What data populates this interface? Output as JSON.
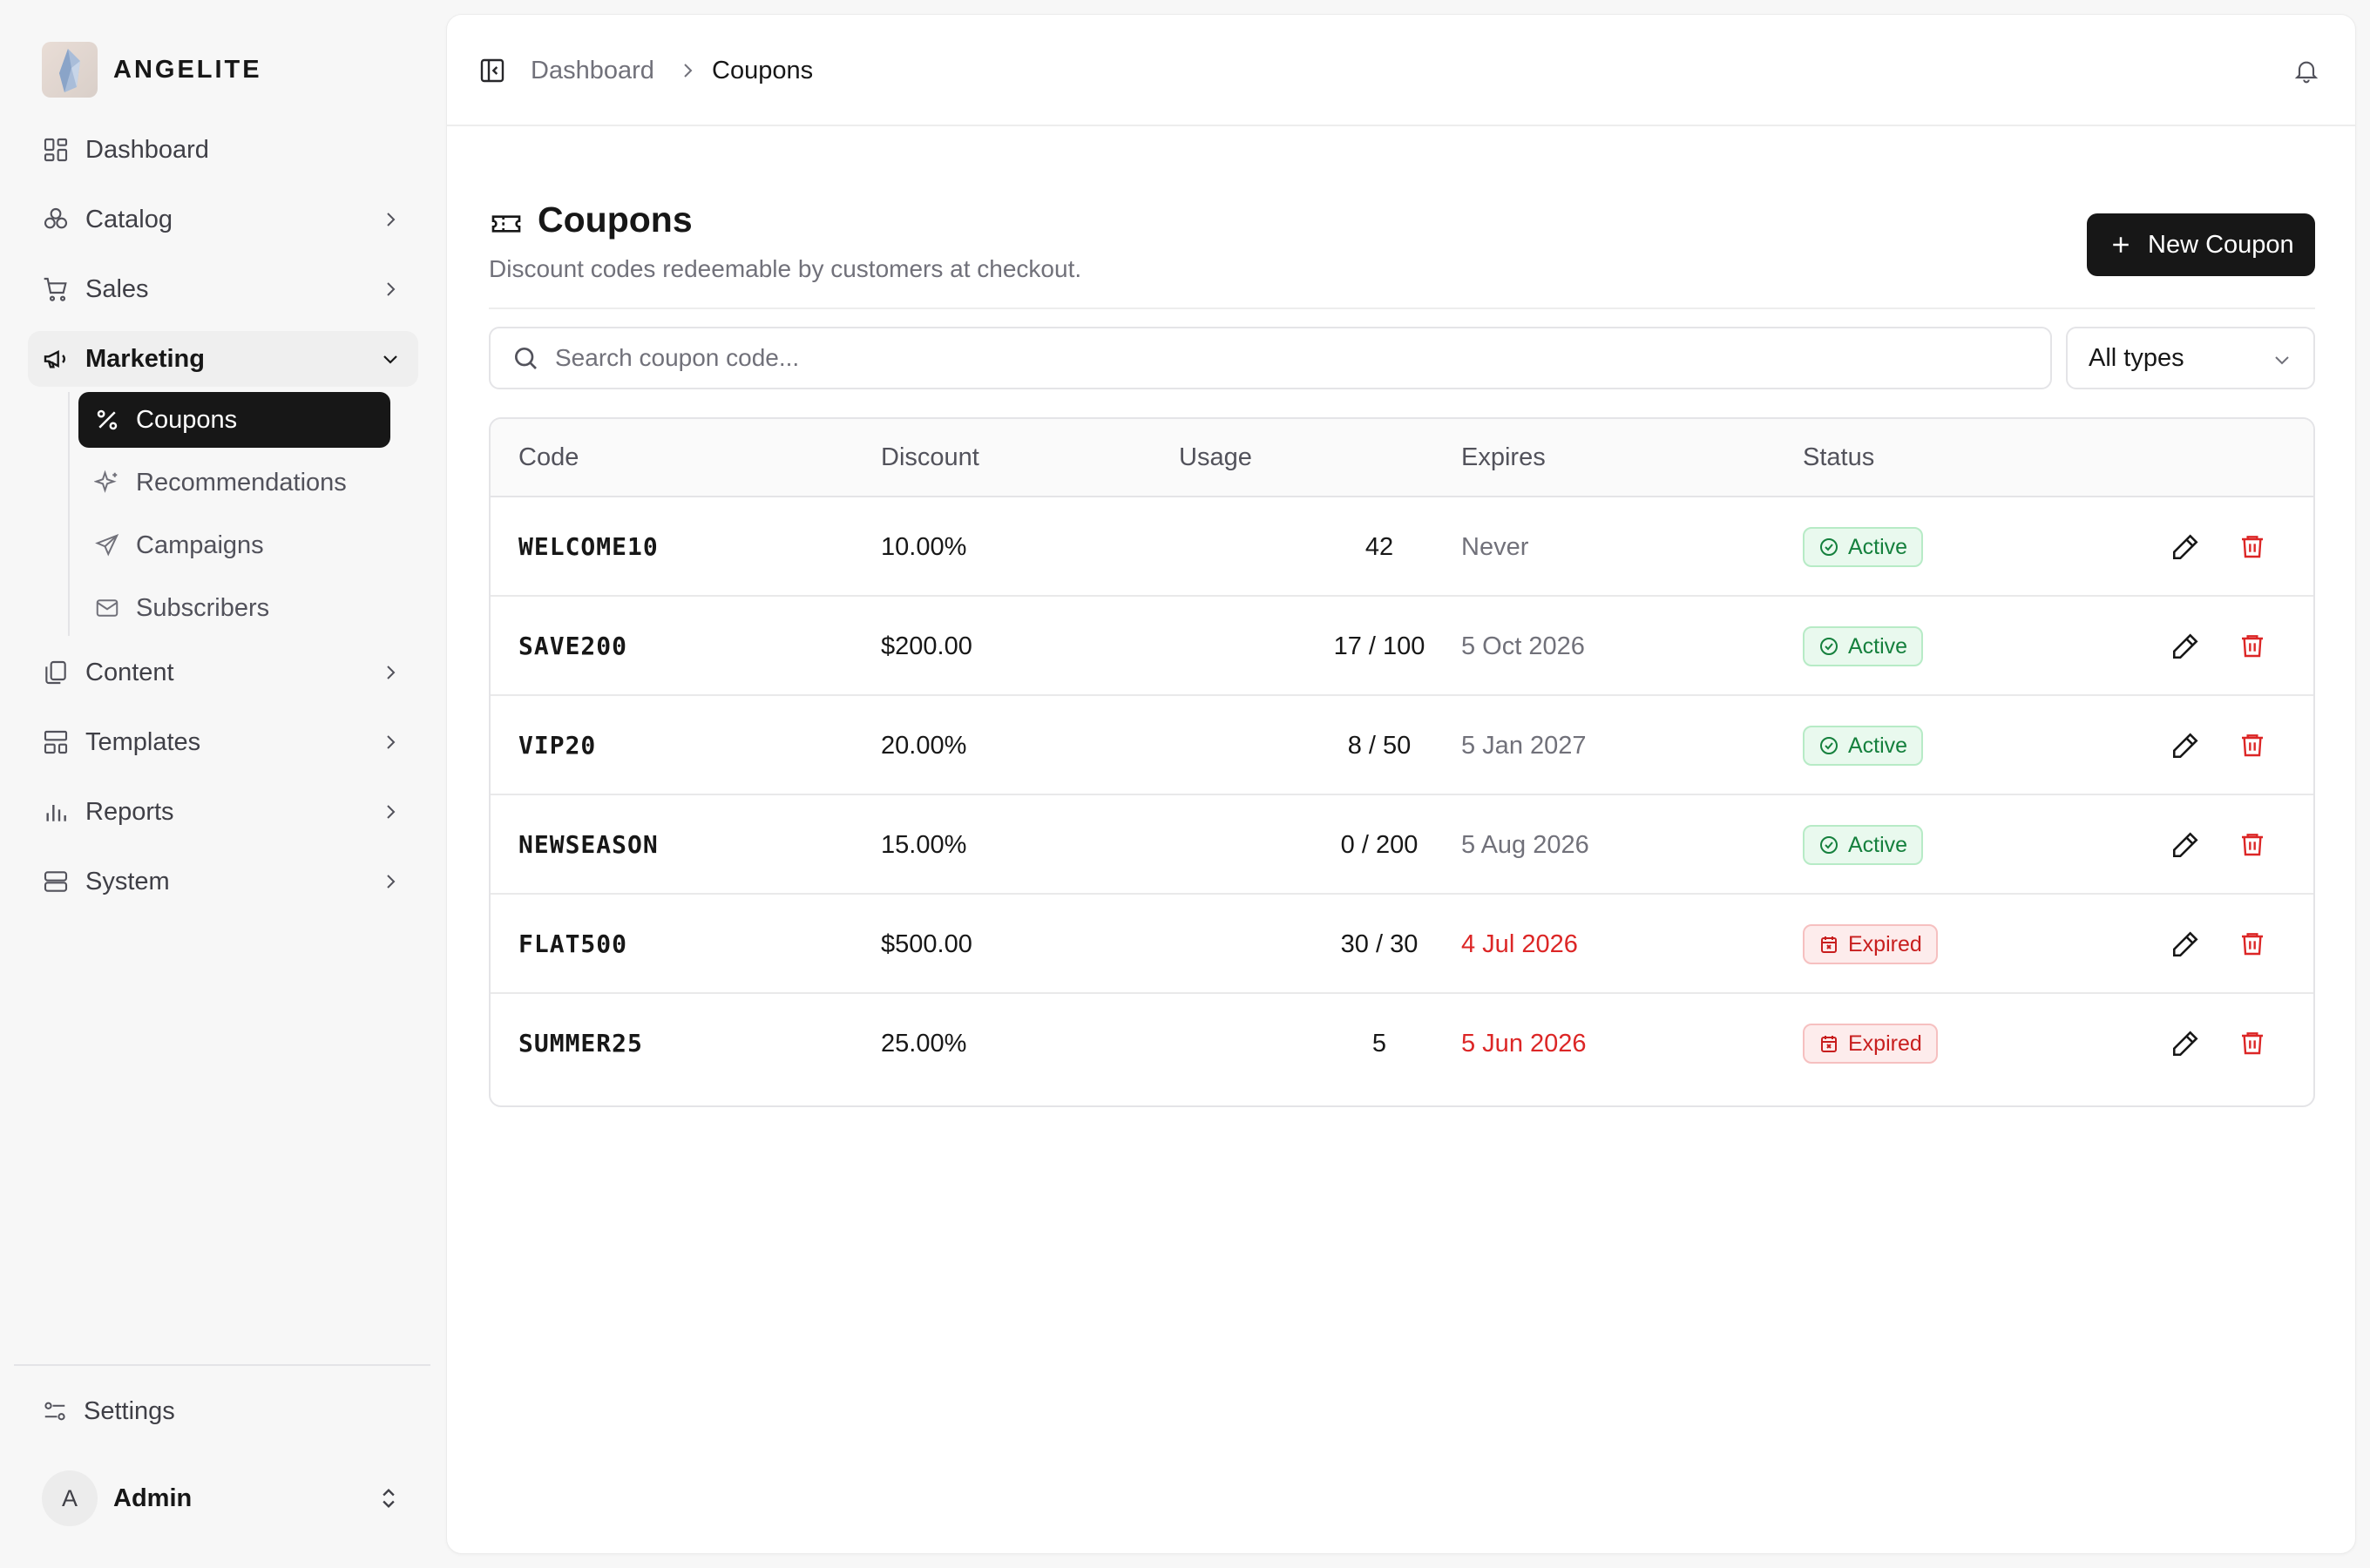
{
  "brand": {
    "name": "ANGELITE"
  },
  "sidebar": {
    "items": [
      {
        "label": "Dashboard",
        "icon": "dashboard-icon"
      },
      {
        "label": "Catalog",
        "icon": "catalog-icon"
      },
      {
        "label": "Sales",
        "icon": "cart-icon"
      },
      {
        "label": "Marketing",
        "icon": "megaphone-icon"
      },
      {
        "label": "Content",
        "icon": "copy-icon"
      },
      {
        "label": "Templates",
        "icon": "layout-icon"
      },
      {
        "label": "Reports",
        "icon": "bar-chart-icon"
      },
      {
        "label": "System",
        "icon": "server-icon"
      }
    ],
    "marketing_sub": [
      {
        "label": "Coupons",
        "icon": "percent-icon"
      },
      {
        "label": "Recommendations",
        "icon": "sparkles-icon"
      },
      {
        "label": "Campaigns",
        "icon": "send-icon"
      },
      {
        "label": "Subscribers",
        "icon": "mail-icon"
      }
    ],
    "settings_label": "Settings",
    "user": {
      "initial": "A",
      "name": "Admin"
    }
  },
  "breadcrumb": {
    "parent": "Dashboard",
    "current": "Coupons"
  },
  "page": {
    "title": "Coupons",
    "subtitle": "Discount codes redeemable by customers at checkout.",
    "new_button": "New Coupon"
  },
  "filters": {
    "search_placeholder": "Search coupon code...",
    "type_selected": "All types"
  },
  "table": {
    "headers": {
      "code": "Code",
      "discount": "Discount",
      "usage": "Usage",
      "expires": "Expires",
      "status": "Status"
    },
    "rows": [
      {
        "code": "WELCOME10",
        "discount": "10.00%",
        "usage": "42",
        "expires": "Never",
        "status": "Active"
      },
      {
        "code": "SAVE200",
        "discount": "$200.00",
        "usage": "17 / 100",
        "expires": "5 Oct 2026",
        "status": "Active"
      },
      {
        "code": "VIP20",
        "discount": "20.00%",
        "usage": "8 / 50",
        "expires": "5 Jan 2027",
        "status": "Active"
      },
      {
        "code": "NEWSEASON",
        "discount": "15.00%",
        "usage": "0 / 200",
        "expires": "5 Aug 2026",
        "status": "Active"
      },
      {
        "code": "FLAT500",
        "discount": "$500.00",
        "usage": "30 / 30",
        "expires": "4 Jul 2026",
        "status": "Expired"
      },
      {
        "code": "SUMMER25",
        "discount": "25.00%",
        "usage": "5",
        "expires": "5 Jun 2026",
        "status": "Expired"
      }
    ]
  },
  "colors": {
    "accent": "#171717",
    "active": "#15803d",
    "expired": "#dc2626"
  }
}
